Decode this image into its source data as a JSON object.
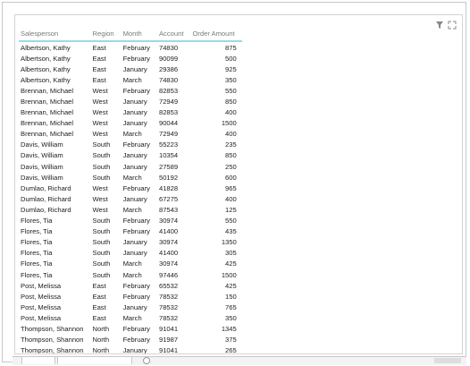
{
  "table": {
    "columns": [
      "Salesperson",
      "Region",
      "Month",
      "Account",
      "Order Amount"
    ],
    "rows": [
      [
        "Albertson, Kathy",
        "East",
        "February",
        "74830",
        "875"
      ],
      [
        "Albertson, Kathy",
        "East",
        "February",
        "90099",
        "500"
      ],
      [
        "Albertson, Kathy",
        "East",
        "January",
        "29386",
        "925"
      ],
      [
        "Albertson, Kathy",
        "East",
        "March",
        "74830",
        "350"
      ],
      [
        "Brennan, Michael",
        "West",
        "February",
        "82853",
        "550"
      ],
      [
        "Brennan, Michael",
        "West",
        "January",
        "72949",
        "850"
      ],
      [
        "Brennan, Michael",
        "West",
        "January",
        "82853",
        "400"
      ],
      [
        "Brennan, Michael",
        "West",
        "January",
        "90044",
        "1500"
      ],
      [
        "Brennan, Michael",
        "West",
        "March",
        "72949",
        "400"
      ],
      [
        "Davis, William",
        "South",
        "February",
        "55223",
        "235"
      ],
      [
        "Davis, William",
        "South",
        "January",
        "10354",
        "850"
      ],
      [
        "Davis, William",
        "South",
        "January",
        "27589",
        "250"
      ],
      [
        "Davis, William",
        "South",
        "March",
        "50192",
        "600"
      ],
      [
        "Dumlao, Richard",
        "West",
        "February",
        "41828",
        "965"
      ],
      [
        "Dumlao, Richard",
        "West",
        "January",
        "67275",
        "400"
      ],
      [
        "Dumlao, Richard",
        "West",
        "March",
        "87543",
        "125"
      ],
      [
        "Flores, Tia",
        "South",
        "February",
        "30974",
        "550"
      ],
      [
        "Flores, Tia",
        "South",
        "February",
        "41400",
        "435"
      ],
      [
        "Flores, Tia",
        "South",
        "January",
        "30974",
        "1350"
      ],
      [
        "Flores, Tia",
        "South",
        "January",
        "41400",
        "305"
      ],
      [
        "Flores, Tia",
        "South",
        "March",
        "30974",
        "425"
      ],
      [
        "Flores, Tia",
        "South",
        "March",
        "97446",
        "1500"
      ],
      [
        "Post, Melissa",
        "East",
        "February",
        "65532",
        "425"
      ],
      [
        "Post, Melissa",
        "East",
        "February",
        "78532",
        "150"
      ],
      [
        "Post, Melissa",
        "East",
        "January",
        "78532",
        "765"
      ],
      [
        "Post, Melissa",
        "East",
        "March",
        "78532",
        "350"
      ],
      [
        "Thompson, Shannon",
        "North",
        "February",
        "91041",
        "1345"
      ],
      [
        "Thompson, Shannon",
        "North",
        "February",
        "91987",
        "375"
      ],
      [
        "Thompson, Shannon",
        "North",
        "January",
        "91041",
        "265"
      ]
    ]
  },
  "icons": {
    "filter": "filter-icon",
    "focus_mode": "focus-mode-icon",
    "add_page": "add-page-icon"
  },
  "colors": {
    "header_underline": "#9bd9e6"
  }
}
